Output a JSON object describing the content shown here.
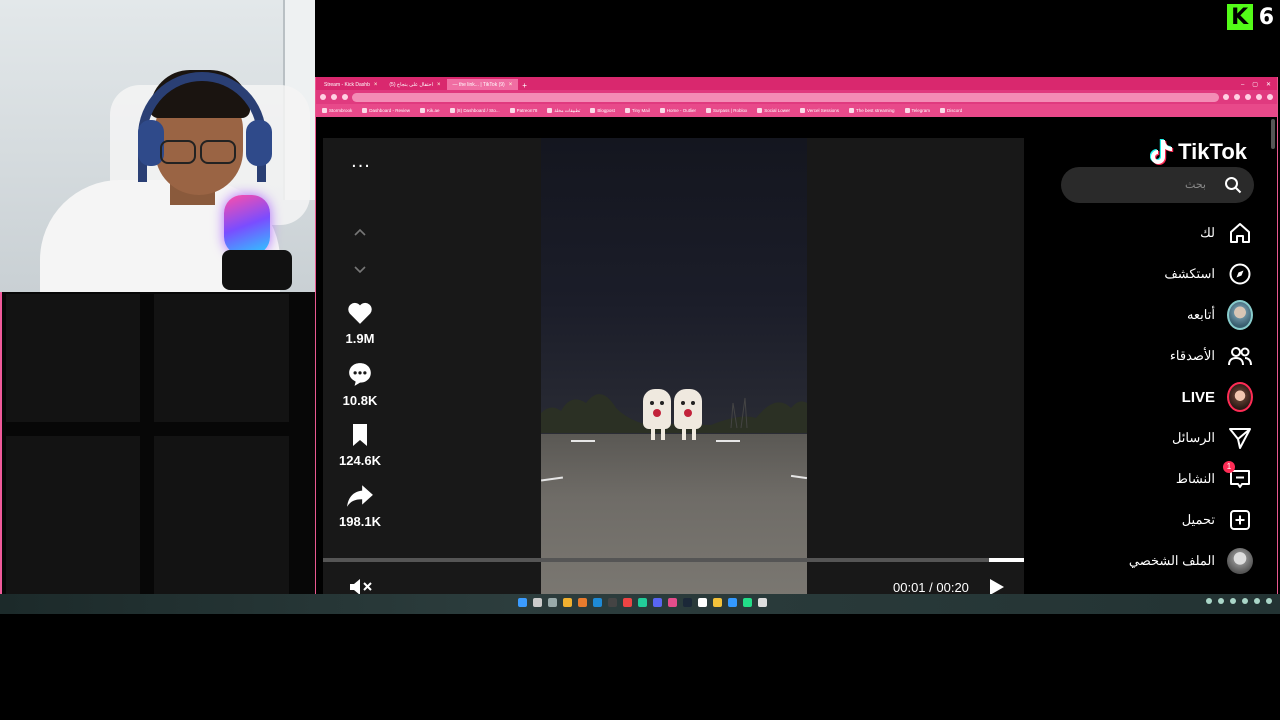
{
  "overlay": {
    "kick_count": "6",
    "kick_letter": "K",
    "kick_color": "#53fc18"
  },
  "browser": {
    "tabs": [
      {
        "label": "Stream - Kick Dashb",
        "active": false
      },
      {
        "label": "احتفال على بنجاح (5)",
        "active": false
      },
      {
        "label": "— the link... | TikTok (9)",
        "active": true
      }
    ],
    "new_tab": "+",
    "bookmarks": [
      "Stormbrook",
      "Dashboard - Review",
      "Kik.ae",
      "(8) Dashboard / Sto...",
      "Patreon78",
      "تطبيقات مخلة",
      "Blogpost",
      "Tiny Mail",
      "Home - Outlier",
      "Surpass | Roblox",
      "Social Lower",
      "Vercel Sessions",
      "The best streaming",
      "Telegram",
      "Discord"
    ],
    "accent": "#d9286e"
  },
  "video": {
    "more_label": "...",
    "likes": "1.9M",
    "comments": "10.8K",
    "saves": "124.6K",
    "shares": "198.1K",
    "time": "00:01 / 00:20",
    "progress": 0.95
  },
  "sidebar": {
    "logo": "TikTok",
    "search_placeholder": "بحث",
    "items": [
      {
        "label": "لك",
        "icon": "home-icon"
      },
      {
        "label": "استكشف",
        "icon": "compass-icon"
      },
      {
        "label": "أتابعه",
        "icon": "following-avatar"
      },
      {
        "label": "الأصدقاء",
        "icon": "friends-icon"
      },
      {
        "label": "LIVE",
        "icon": "live-avatar"
      },
      {
        "label": "الرسائل",
        "icon": "send-icon"
      },
      {
        "label": "النشاط",
        "icon": "activity-icon",
        "badge": "1"
      },
      {
        "label": "تحميل",
        "icon": "upload-icon"
      },
      {
        "label": "الملف الشخصي",
        "icon": "profile-avatar"
      }
    ]
  }
}
